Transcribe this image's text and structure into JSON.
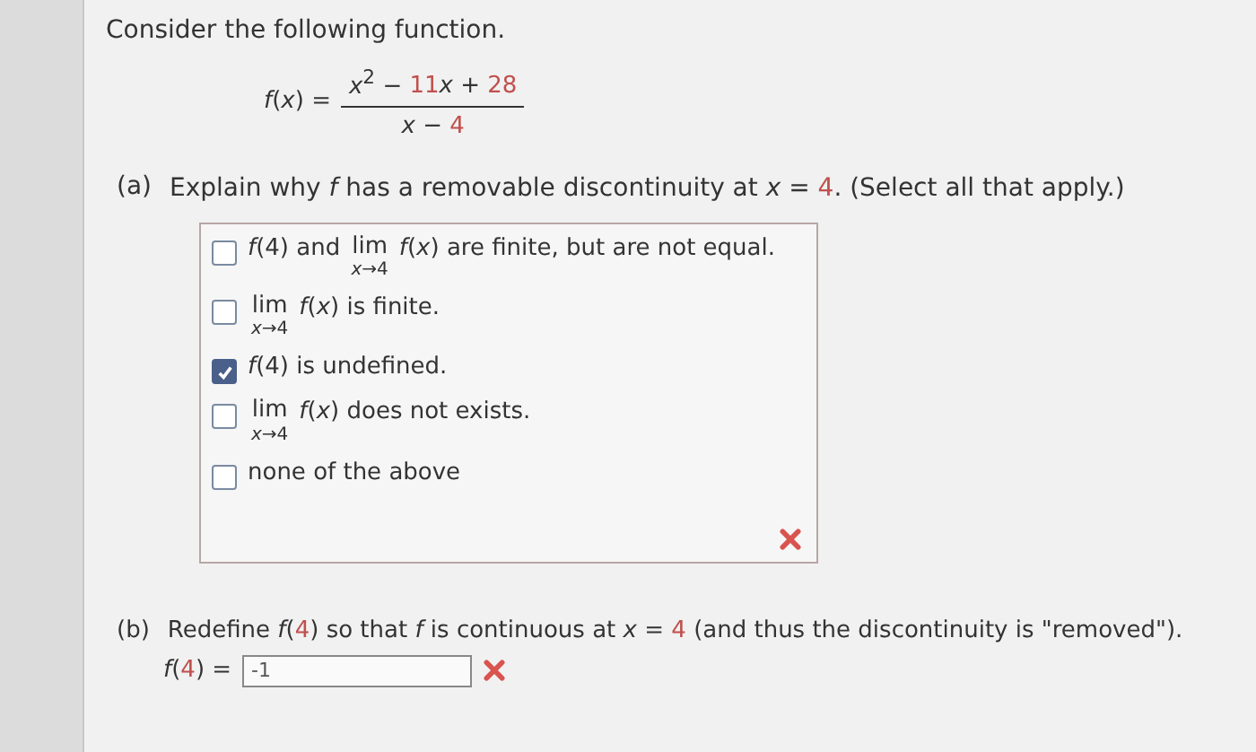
{
  "intro": "Consider the following function.",
  "formula": {
    "lhs": "*f*(*x*) =",
    "numerator": [
      {
        "kind": "plain",
        "text": "*x*$^{2}$ − "
      },
      {
        "kind": "given",
        "text": "11"
      },
      {
        "kind": "plain",
        "text": "*x* + "
      },
      {
        "kind": "given",
        "text": "28"
      }
    ],
    "denominator": [
      {
        "kind": "plain",
        "text": "*x* − "
      },
      {
        "kind": "given",
        "text": "4"
      }
    ]
  },
  "part_a": {
    "label": "(a)",
    "question": [
      {
        "kind": "plain",
        "text": "Explain why *f* has a removable discontinuity at *x* = "
      },
      {
        "kind": "given",
        "text": "4"
      },
      {
        "kind": "plain",
        "text": ". (Select all that apply.)"
      }
    ],
    "options": [
      {
        "checked": false,
        "before": "*f*(4) and",
        "limit": {
          "word": "lim",
          "sub": "*x*→4"
        },
        "after": "*f*(*x*) are finite, but are not equal."
      },
      {
        "checked": false,
        "limit": {
          "word": "lim",
          "sub": "*x*→4"
        },
        "after": "*f*(*x*) is finite."
      },
      {
        "checked": true,
        "after": "*f*(4) is undefined."
      },
      {
        "checked": false,
        "limit": {
          "word": "lim",
          "sub": "*x*→4"
        },
        "after": "*f*(*x*) does not exists."
      },
      {
        "checked": false,
        "after": "none of the above"
      }
    ],
    "incorrect": true
  },
  "part_b": {
    "label": "(b)",
    "question": [
      {
        "kind": "plain",
        "text": "Redefine *f*("
      },
      {
        "kind": "given",
        "text": "4"
      },
      {
        "kind": "plain",
        "text": ") so that *f* is continuous at *x* = "
      },
      {
        "kind": "given",
        "text": "4"
      },
      {
        "kind": "plain",
        "text": " (and thus the discontinuity is \"removed\")."
      }
    ],
    "answer_label": [
      {
        "kind": "plain",
        "text": "*f*("
      },
      {
        "kind": "given",
        "text": "4"
      },
      {
        "kind": "plain",
        "text": ") ="
      }
    ],
    "answer": "-1",
    "incorrect": true
  }
}
